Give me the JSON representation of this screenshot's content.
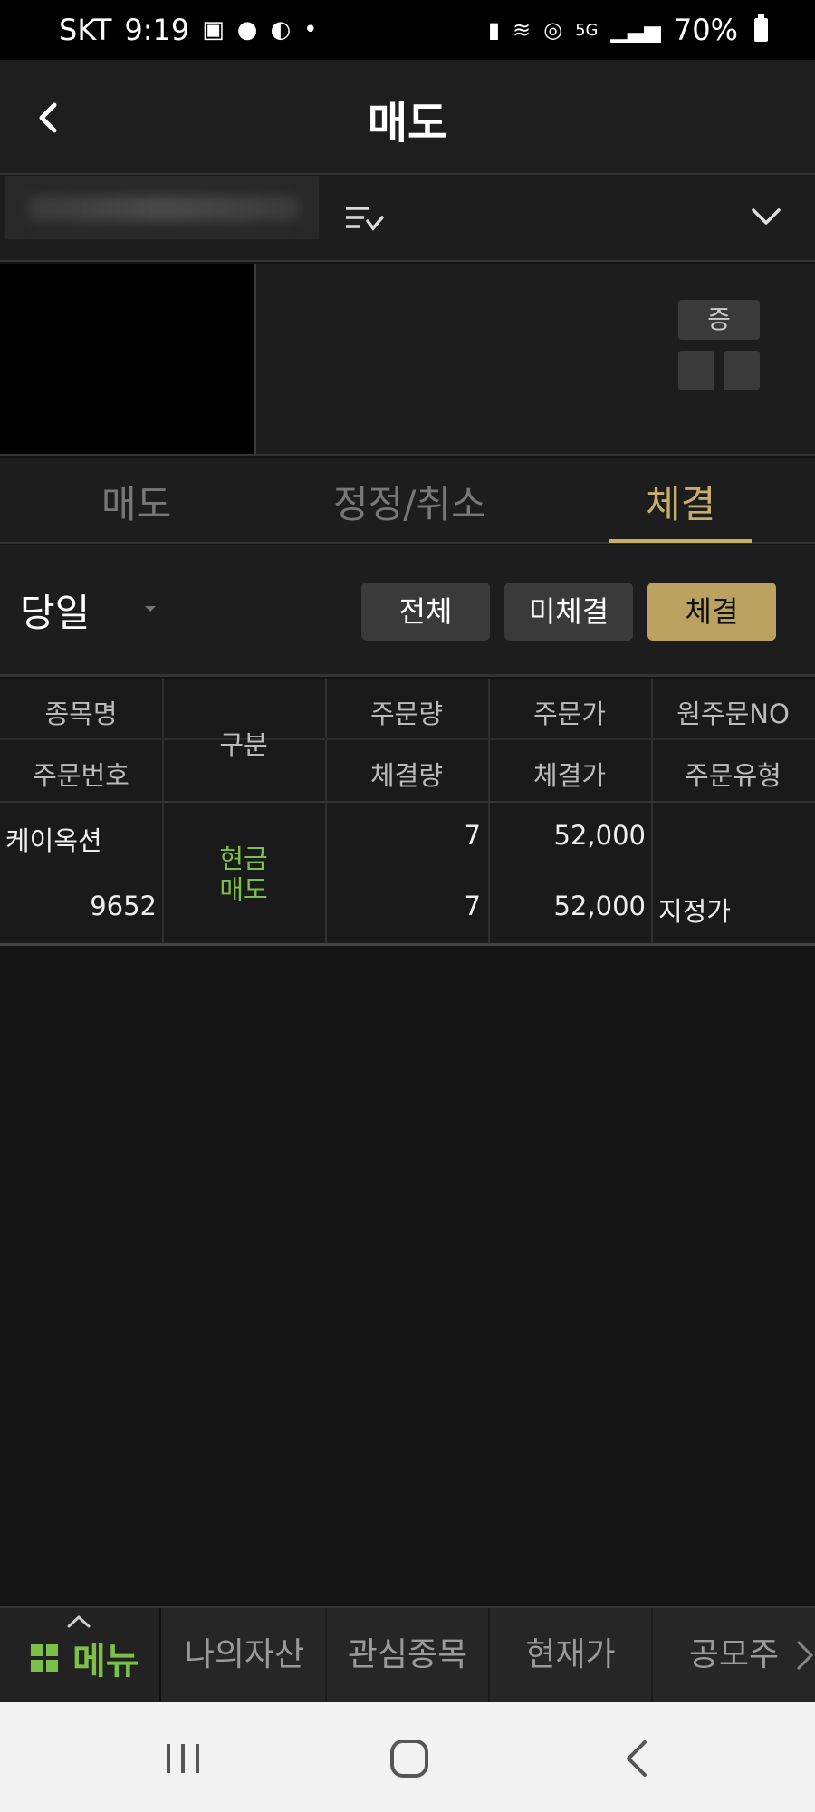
{
  "status_bar": {
    "carrier": "SKT",
    "time": "9:19",
    "network": "5G",
    "battery": "70%"
  },
  "header": {
    "title": "매도"
  },
  "stock": {
    "margin_label": "증"
  },
  "tabs": [
    {
      "label": "매도",
      "active": false
    },
    {
      "label": "정정/취소",
      "active": false
    },
    {
      "label": "체결",
      "active": true
    }
  ],
  "filter": {
    "date_value": "당일",
    "buttons": [
      {
        "label": "전체",
        "active": false
      },
      {
        "label": "미체결",
        "active": false
      },
      {
        "label": "체결",
        "active": true
      }
    ]
  },
  "table": {
    "headers": {
      "col1_top": "종목명",
      "col1_bottom": "주문번호",
      "col2": "구분",
      "col3_top": "주문량",
      "col3_bottom": "체결량",
      "col4_top": "주문가",
      "col4_bottom": "체결가",
      "col5_top": "원주문NO",
      "col5_bottom": "주문유형"
    },
    "rows": [
      {
        "name": "케이옥션",
        "order_no": "9652",
        "type_line1": "현금",
        "type_line2": "매도",
        "order_qty": "7",
        "filled_qty": "7",
        "order_price": "52,000",
        "filled_price": "52,000",
        "orig_order_no": "",
        "order_type": "지정가"
      }
    ]
  },
  "bottom_nav": {
    "menu_label": "메뉴",
    "items": [
      "나의자산",
      "관심종목",
      "현재가",
      "공모주"
    ]
  },
  "colors": {
    "accent_gold": "#c8ad6a",
    "button_gold": "#bba260",
    "sell_green": "#7cc04a"
  }
}
